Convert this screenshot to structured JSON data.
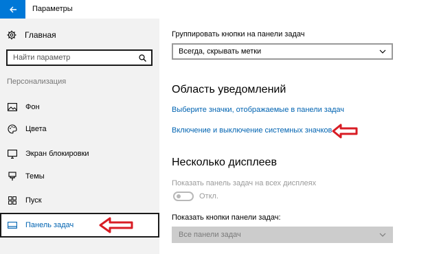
{
  "window": {
    "title": "Параметры"
  },
  "sidebar": {
    "home_label": "Главная",
    "search_placeholder": "Найти параметр",
    "section_label": "Персонализация",
    "items": [
      {
        "label": "Фон",
        "icon": "picture-icon"
      },
      {
        "label": "Цвета",
        "icon": "palette-icon"
      },
      {
        "label": "Экран блокировки",
        "icon": "monitor-icon"
      },
      {
        "label": "Темы",
        "icon": "brush-icon"
      },
      {
        "label": "Пуск",
        "icon": "start-grid-icon"
      },
      {
        "label": "Панель задач",
        "icon": "taskbar-icon",
        "active": true
      }
    ]
  },
  "main": {
    "group_buttons_label": "Группировать кнопки на панели задач",
    "group_buttons_value": "Всегда, скрывать метки",
    "notification_area_heading": "Область уведомлений",
    "link_select_icons": "Выберите значки, отображаемые в панели задач",
    "link_system_icons": "Включение и выключение системных значков",
    "multiple_displays_heading": "Несколько дисплеев",
    "show_taskbar_all_label": "Показать панель задач на всех дисплеях",
    "toggle_state": "Откл.",
    "show_buttons_label": "Показать кнопки панели задач:",
    "show_buttons_value": "Все панели задач"
  },
  "colors": {
    "accent": "#0078d7",
    "link": "#0063b1",
    "annotation_arrow": "#d81c24"
  }
}
